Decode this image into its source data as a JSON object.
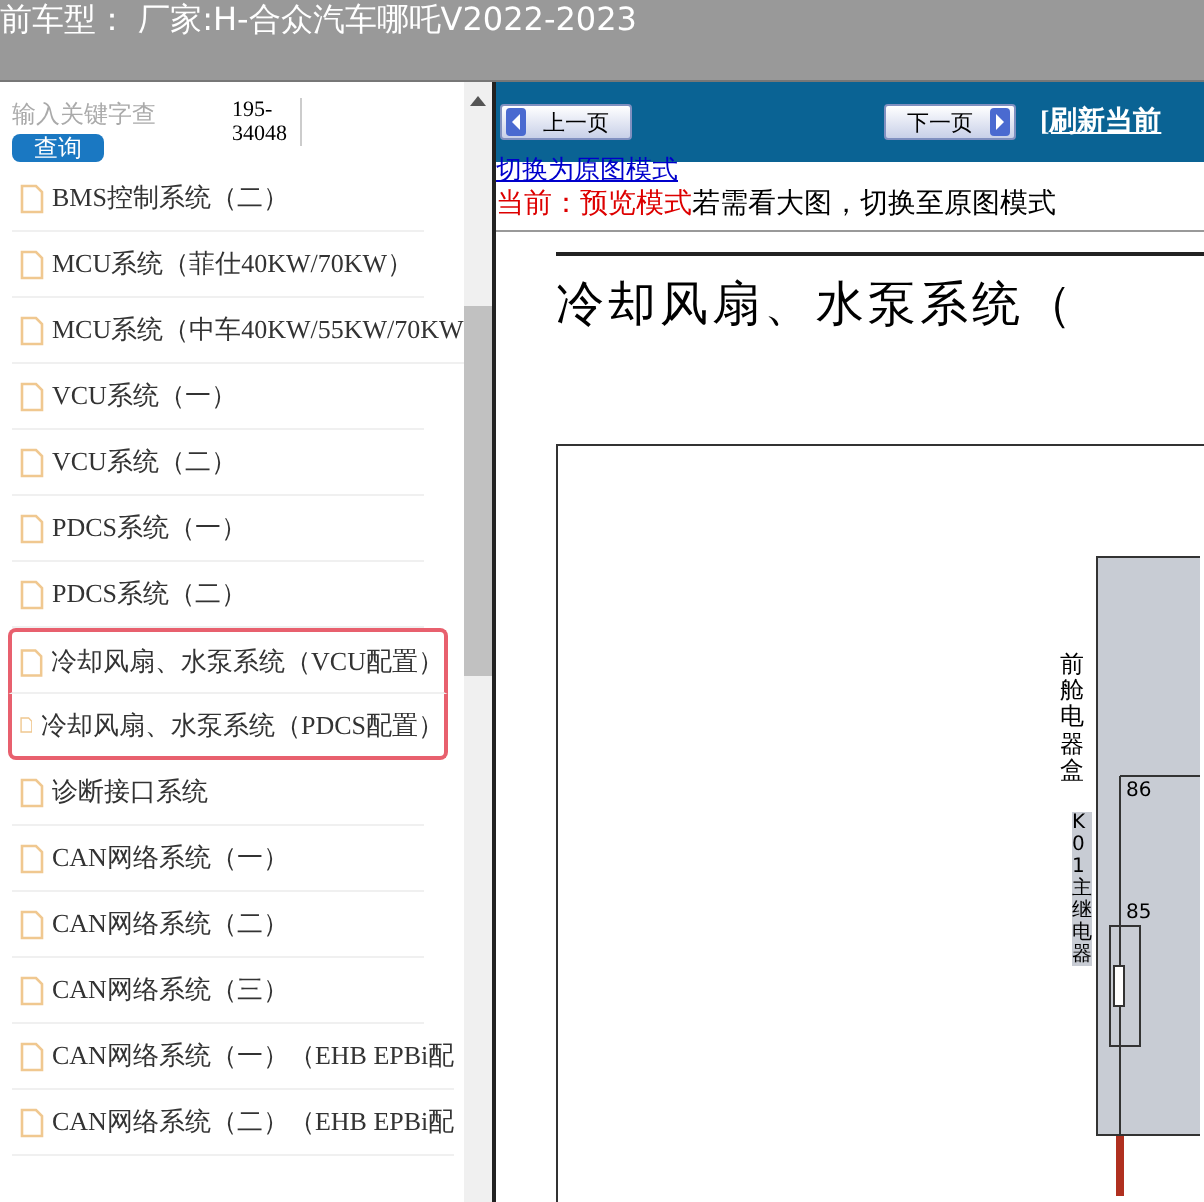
{
  "header": {
    "title": "前车型： 厂家:H-合众汽车哪吒V2022-2023"
  },
  "sidebar": {
    "search": {
      "placeholder": "输入关键字查",
      "button": "查询",
      "count": "195-34048"
    },
    "items": [
      {
        "label": "BMS控制系统（二）",
        "selected": false
      },
      {
        "label": "MCU系统（菲仕40KW/70KW）",
        "selected": false
      },
      {
        "label": "MCU系统（中车40KW/55KW/70KW",
        "selected": false
      },
      {
        "label": "VCU系统（一）",
        "selected": false
      },
      {
        "label": "VCU系统（二）",
        "selected": false
      },
      {
        "label": "PDCS系统（一）",
        "selected": false
      },
      {
        "label": "PDCS系统（二）",
        "selected": false
      },
      {
        "label": "冷却风扇、水泵系统（VCU配置）",
        "selected": true
      },
      {
        "label": "冷却风扇、水泵系统（PDCS配置）",
        "selected": true
      },
      {
        "label": "诊断接口系统",
        "selected": false
      },
      {
        "label": "CAN网络系统（一）",
        "selected": false
      },
      {
        "label": "CAN网络系统（二）",
        "selected": false
      },
      {
        "label": "CAN网络系统（三）",
        "selected": false
      },
      {
        "label": "CAN网络系统（一）（EHB EPBi配",
        "selected": false
      },
      {
        "label": "CAN网络系统（二）（EHB EPBi配",
        "selected": false
      }
    ]
  },
  "toolbar": {
    "prev_button": "上一页",
    "next_button": "下一页",
    "refresh_link": "[刷新当前"
  },
  "mode_link": "切换为原图模式",
  "mode_notice": {
    "status": "当前：预览模式",
    "hint": "若需看大图，切换至原图模式"
  },
  "diagram": {
    "title": "冷却风扇、水泵系统（",
    "box_label": "前舱电器盒",
    "relay_label": "K01 主继电器",
    "pins": [
      "86",
      "85"
    ]
  }
}
